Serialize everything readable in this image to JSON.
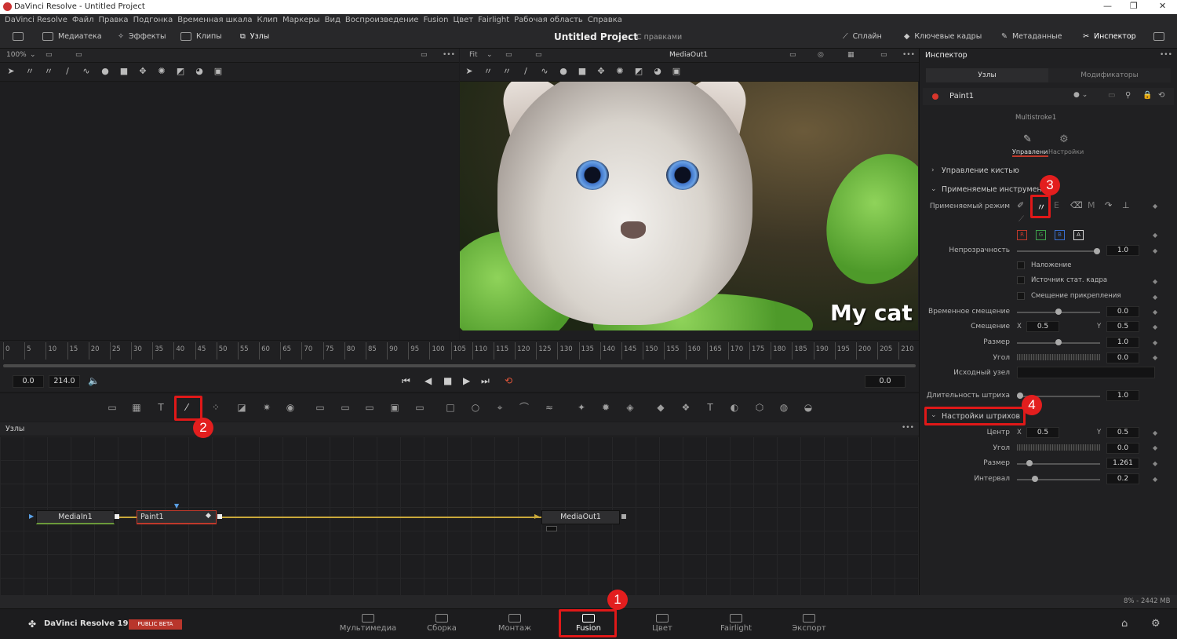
{
  "window": {
    "title": "DaVinci Resolve - Untitled Project"
  },
  "menu": [
    "DaVinci Resolve",
    "Файл",
    "Правка",
    "Подгонка",
    "Временная шкала",
    "Клип",
    "Маркеры",
    "Вид",
    "Воспроизведение",
    "Fusion",
    "Цвет",
    "Fairlight",
    "Рабочая область",
    "Справка"
  ],
  "toolbar": {
    "media_pool": "Медиатека",
    "effects": "Эффекты",
    "clips": "Клипы",
    "nodes": "Узлы",
    "project_title": "Untitled Project",
    "project_status": "С правками",
    "spline": "Сплайн",
    "keyframes": "Ключевые кадры",
    "metadata": "Метаданные",
    "inspector": "Инспектор"
  },
  "viewer_left": {
    "zoom": "100%"
  },
  "viewer_right": {
    "fit": "Fit",
    "name": "MediaOut1",
    "overlay_text": "My cat"
  },
  "timeline": {
    "ticks": [
      "0",
      "5",
      "10",
      "15",
      "20",
      "25",
      "30",
      "35",
      "40",
      "45",
      "50",
      "55",
      "60",
      "65",
      "70",
      "75",
      "80",
      "85",
      "90",
      "95",
      "100",
      "105",
      "110",
      "115",
      "120",
      "125",
      "130",
      "135",
      "140",
      "145",
      "150",
      "155",
      "160",
      "165",
      "170",
      "175",
      "180",
      "185",
      "190",
      "195",
      "200",
      "205",
      "210"
    ],
    "start": "0.0",
    "end": "214.0",
    "current": "0.0"
  },
  "nodes_panel": {
    "title": "Узлы",
    "nodes": [
      "MediaIn1",
      "Paint1",
      "MediaOut1"
    ]
  },
  "inspector": {
    "title": "Инспектор",
    "tabs": [
      "Узлы",
      "Модификаторы"
    ],
    "node_name": "Paint1",
    "modifier": "Multistroke1",
    "subtabs": [
      "Управления",
      "Настройки"
    ],
    "brush_controls": "Управление кистью",
    "applied_tools": "Применяемые инструменты",
    "apply_mode": "Применяемый режим",
    "channels": [
      "R",
      "G",
      "B",
      "A"
    ],
    "opacity_label": "Непрозрачность",
    "opacity": "1.0",
    "checkboxes": [
      "Наложение",
      "Источник стат. кадра",
      "Смещение прикрепления"
    ],
    "time_offset_label": "Временное смещение",
    "time_offset": "0.0",
    "offset_label": "Смещение",
    "offset_x": "0.5",
    "offset_y": "0.5",
    "size_label": "Размер",
    "size": "1.0",
    "angle_label": "Угол",
    "angle": "0.0",
    "source_node_label": "Исходный узел",
    "stroke_duration_label": "Длительность штриха",
    "stroke_duration": "1.0",
    "stroke_settings": "Настройки штрихов",
    "center_label": "Центр",
    "center_x": "0.5",
    "center_y": "0.5",
    "angle2_label": "Угол",
    "angle2": "0.0",
    "size2_label": "Размер",
    "size2": "1.261",
    "spacing_label": "Интервал",
    "spacing": "0.2",
    "x": "X",
    "y": "Y"
  },
  "status": {
    "memory": "8% - 2442 MB"
  },
  "bottom": {
    "app_name": "DaVinci Resolve 19",
    "beta": "PUBLIC BETA",
    "pages": [
      "Мультимедиа",
      "Сборка",
      "Монтаж",
      "Fusion",
      "Цвет",
      "Fairlight",
      "Экспорт"
    ]
  },
  "badges": [
    "1",
    "2",
    "3",
    "4"
  ],
  "colors": {
    "accent_red": "#e01818",
    "connector": "#c9a83a",
    "active_page": "#ffffff"
  }
}
